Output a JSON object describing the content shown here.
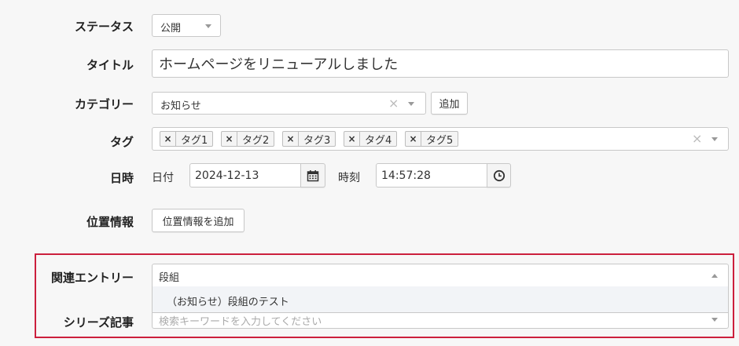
{
  "status": {
    "label": "ステータス",
    "value": "公開"
  },
  "title": {
    "label": "タイトル",
    "value": "ホームページをリニューアルしました"
  },
  "category": {
    "label": "カテゴリー",
    "value": "お知らせ",
    "add_button": "追加"
  },
  "tags": {
    "label": "タグ",
    "items": [
      "タグ1",
      "タグ2",
      "タグ3",
      "タグ4",
      "タグ5"
    ],
    "remove_glyph": "×"
  },
  "datetime": {
    "label": "日時",
    "date_label": "日付",
    "date_value": "2024-12-13",
    "time_label": "時刻",
    "time_value": "14:57:28"
  },
  "location": {
    "label": "位置情報",
    "add_button": "位置情報を追加"
  },
  "related": {
    "label": "関連エントリー",
    "input_value": "段組",
    "suggestion": "（お知らせ）段組のテスト"
  },
  "series": {
    "label": "シリーズ記事",
    "placeholder": "検索キーワードを入力してください"
  },
  "colors": {
    "highlight_border": "#cc1f3d",
    "background": "#f7f7f7",
    "border": "#c8c8c8"
  },
  "icons": {
    "calendar": "calendar-icon",
    "clock": "clock-icon",
    "clear": "clear-icon",
    "caret": "caret-down-icon"
  }
}
